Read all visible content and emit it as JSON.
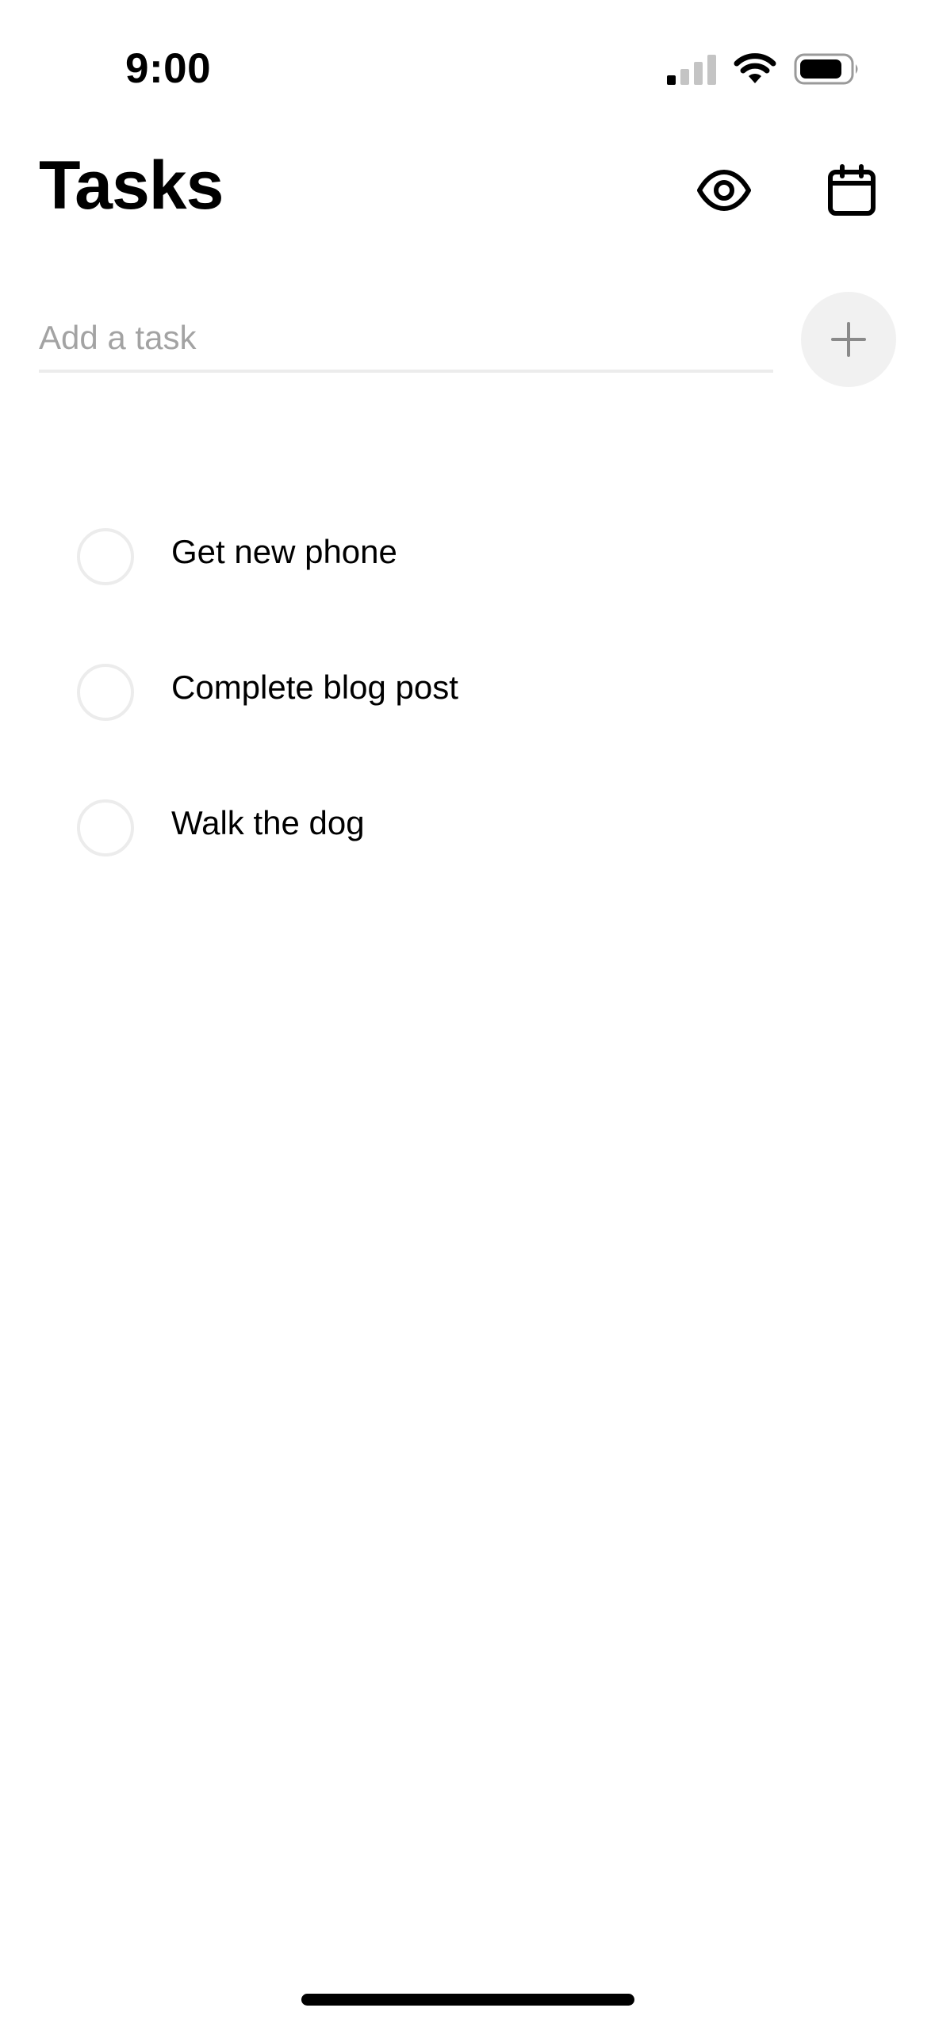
{
  "status_bar": {
    "time": "9:00",
    "icons": [
      "signal-icon",
      "wifi-icon",
      "battery-icon"
    ]
  },
  "header": {
    "title": "Tasks",
    "icons": [
      "eye-icon",
      "calendar-icon"
    ]
  },
  "add_task": {
    "placeholder": "Add a task",
    "value": "",
    "button_icon": "plus-icon"
  },
  "tasks": [
    {
      "label": "Get new phone",
      "completed": false
    },
    {
      "label": "Complete blog post",
      "completed": false
    },
    {
      "label": "Walk the dog",
      "completed": false
    }
  ],
  "colors": {
    "text": "#000000",
    "placeholder": "#a3a3a3",
    "divider": "#ececec",
    "add_button_bg": "#f1f1f1",
    "plus_icon": "#8a8a8a"
  }
}
